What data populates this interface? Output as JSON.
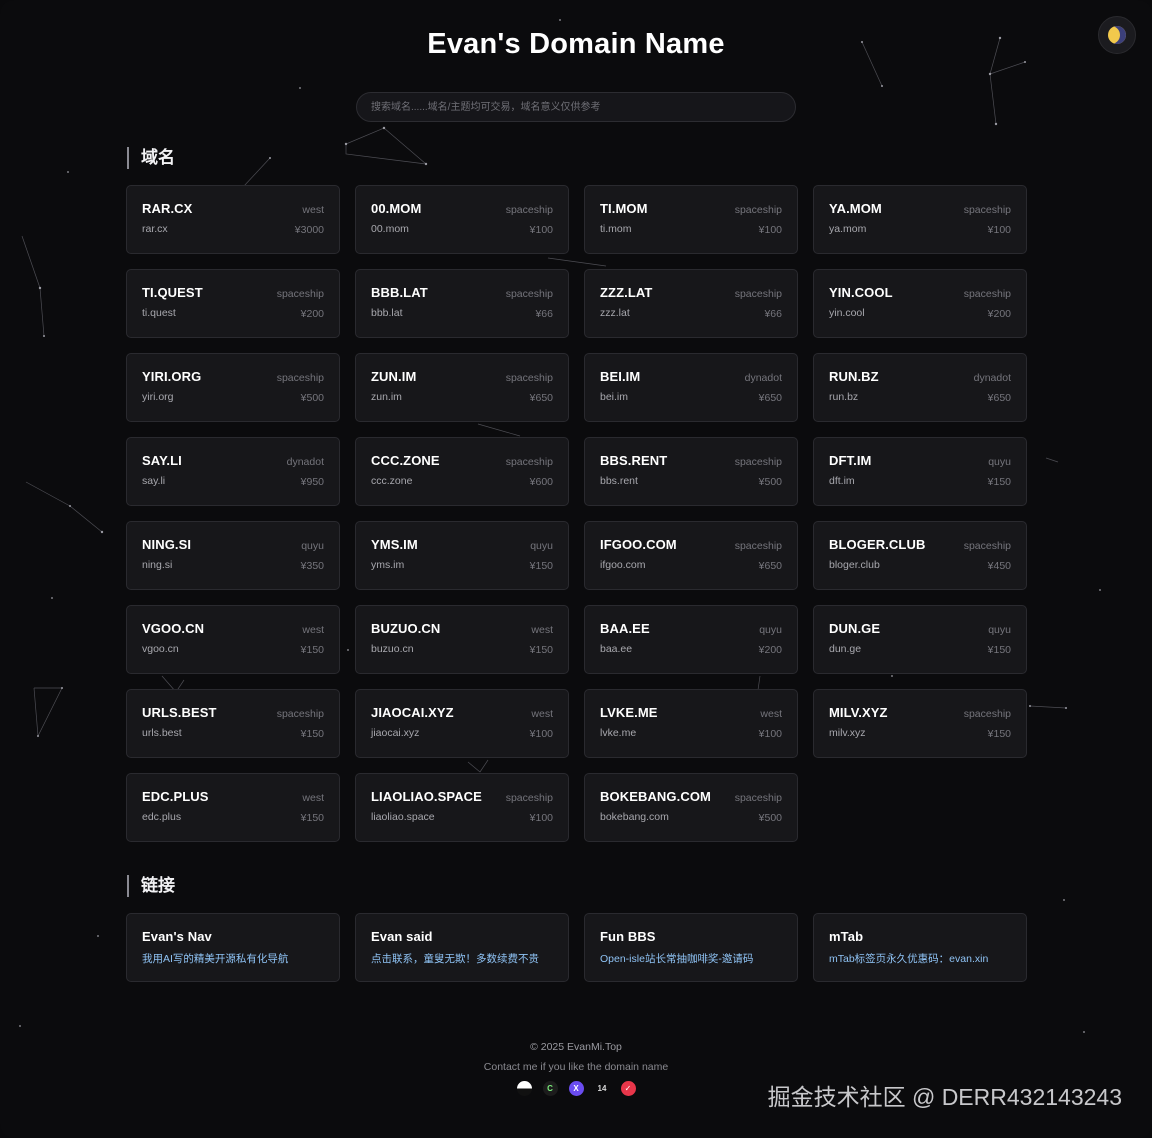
{
  "header": {
    "title": "Evan's Domain Name",
    "theme_icon": "moon-icon"
  },
  "search": {
    "placeholder": "搜索域名......域名/主题均可交易，域名意义仅供参考"
  },
  "domains_section": {
    "title": "域名",
    "items": [
      {
        "name": "RAR.CX",
        "domain": "rar.cx",
        "registrar": "west",
        "price": "¥3000"
      },
      {
        "name": "00.MOM",
        "domain": "00.mom",
        "registrar": "spaceship",
        "price": "¥100"
      },
      {
        "name": "TI.MOM",
        "domain": "ti.mom",
        "registrar": "spaceship",
        "price": "¥100"
      },
      {
        "name": "YA.MOM",
        "domain": "ya.mom",
        "registrar": "spaceship",
        "price": "¥100"
      },
      {
        "name": "TI.QUEST",
        "domain": "ti.quest",
        "registrar": "spaceship",
        "price": "¥200"
      },
      {
        "name": "BBB.LAT",
        "domain": "bbb.lat",
        "registrar": "spaceship",
        "price": "¥66"
      },
      {
        "name": "ZZZ.LAT",
        "domain": "zzz.lat",
        "registrar": "spaceship",
        "price": "¥66"
      },
      {
        "name": "YIN.COOL",
        "domain": "yin.cool",
        "registrar": "spaceship",
        "price": "¥200"
      },
      {
        "name": "YIRI.ORG",
        "domain": "yiri.org",
        "registrar": "spaceship",
        "price": "¥500"
      },
      {
        "name": "ZUN.IM",
        "domain": "zun.im",
        "registrar": "spaceship",
        "price": "¥650"
      },
      {
        "name": "BEI.IM",
        "domain": "bei.im",
        "registrar": "dynadot",
        "price": "¥650"
      },
      {
        "name": "RUN.BZ",
        "domain": "run.bz",
        "registrar": "dynadot",
        "price": "¥650"
      },
      {
        "name": "SAY.LI",
        "domain": "say.li",
        "registrar": "dynadot",
        "price": "¥950"
      },
      {
        "name": "CCC.ZONE",
        "domain": "ccc.zone",
        "registrar": "spaceship",
        "price": "¥600"
      },
      {
        "name": "BBS.RENT",
        "domain": "bbs.rent",
        "registrar": "spaceship",
        "price": "¥500"
      },
      {
        "name": "DFT.IM",
        "domain": "dft.im",
        "registrar": "quyu",
        "price": "¥150"
      },
      {
        "name": "NING.SI",
        "domain": "ning.si",
        "registrar": "quyu",
        "price": "¥350"
      },
      {
        "name": "YMS.IM",
        "domain": "yms.im",
        "registrar": "quyu",
        "price": "¥150"
      },
      {
        "name": "IFGOO.COM",
        "domain": "ifgoo.com",
        "registrar": "spaceship",
        "price": "¥650"
      },
      {
        "name": "BLOGER.CLUB",
        "domain": "bloger.club",
        "registrar": "spaceship",
        "price": "¥450"
      },
      {
        "name": "VGOO.CN",
        "domain": "vgoo.cn",
        "registrar": "west",
        "price": "¥150"
      },
      {
        "name": "BUZUO.CN",
        "domain": "buzuo.cn",
        "registrar": "west",
        "price": "¥150"
      },
      {
        "name": "BAA.EE",
        "domain": "baa.ee",
        "registrar": "quyu",
        "price": "¥200"
      },
      {
        "name": "DUN.GE",
        "domain": "dun.ge",
        "registrar": "quyu",
        "price": "¥150"
      },
      {
        "name": "URLS.BEST",
        "domain": "urls.best",
        "registrar": "spaceship",
        "price": "¥150"
      },
      {
        "name": "JIAOCAI.XYZ",
        "domain": "jiaocai.xyz",
        "registrar": "west",
        "price": "¥100"
      },
      {
        "name": "LVKE.ME",
        "domain": "lvke.me",
        "registrar": "west",
        "price": "¥100"
      },
      {
        "name": "MILV.XYZ",
        "domain": "milv.xyz",
        "registrar": "spaceship",
        "price": "¥150"
      },
      {
        "name": "EDC.PLUS",
        "domain": "edc.plus",
        "registrar": "west",
        "price": "¥150"
      },
      {
        "name": "LIAOLIAO.SPACE",
        "domain": "liaoliao.space",
        "registrar": "spaceship",
        "price": "¥100"
      },
      {
        "name": "BOKEBANG.COM",
        "domain": "bokebang.com",
        "registrar": "spaceship",
        "price": "¥500"
      }
    ]
  },
  "links_section": {
    "title": "链接",
    "items": [
      {
        "name": "Evan's Nav",
        "desc": "我用AI写的精美开源私有化导航"
      },
      {
        "name": "Evan said",
        "desc": "点击联系，童叟无欺！多数续费不贵"
      },
      {
        "name": "Fun BBS",
        "desc": "Open-isle站长常抽咖啡奖-邀请码"
      },
      {
        "name": "mTab",
        "desc": "mTab标签页永久优惠码：evan.xin"
      }
    ]
  },
  "footer": {
    "copyright": "© 2025 EvanMi.Top",
    "contact": "Contact me if you like the domain name",
    "socials": [
      {
        "icon": "half-circle-icon",
        "glyph": ""
      },
      {
        "icon": "c-logo-icon",
        "glyph": "C"
      },
      {
        "icon": "x-logo-icon",
        "glyph": "X"
      },
      {
        "icon": "number-14-icon",
        "glyph": "14"
      },
      {
        "icon": "red-logo-icon",
        "glyph": "✓"
      }
    ]
  },
  "watermark": "掘金技术社区 @ DERR432143243"
}
